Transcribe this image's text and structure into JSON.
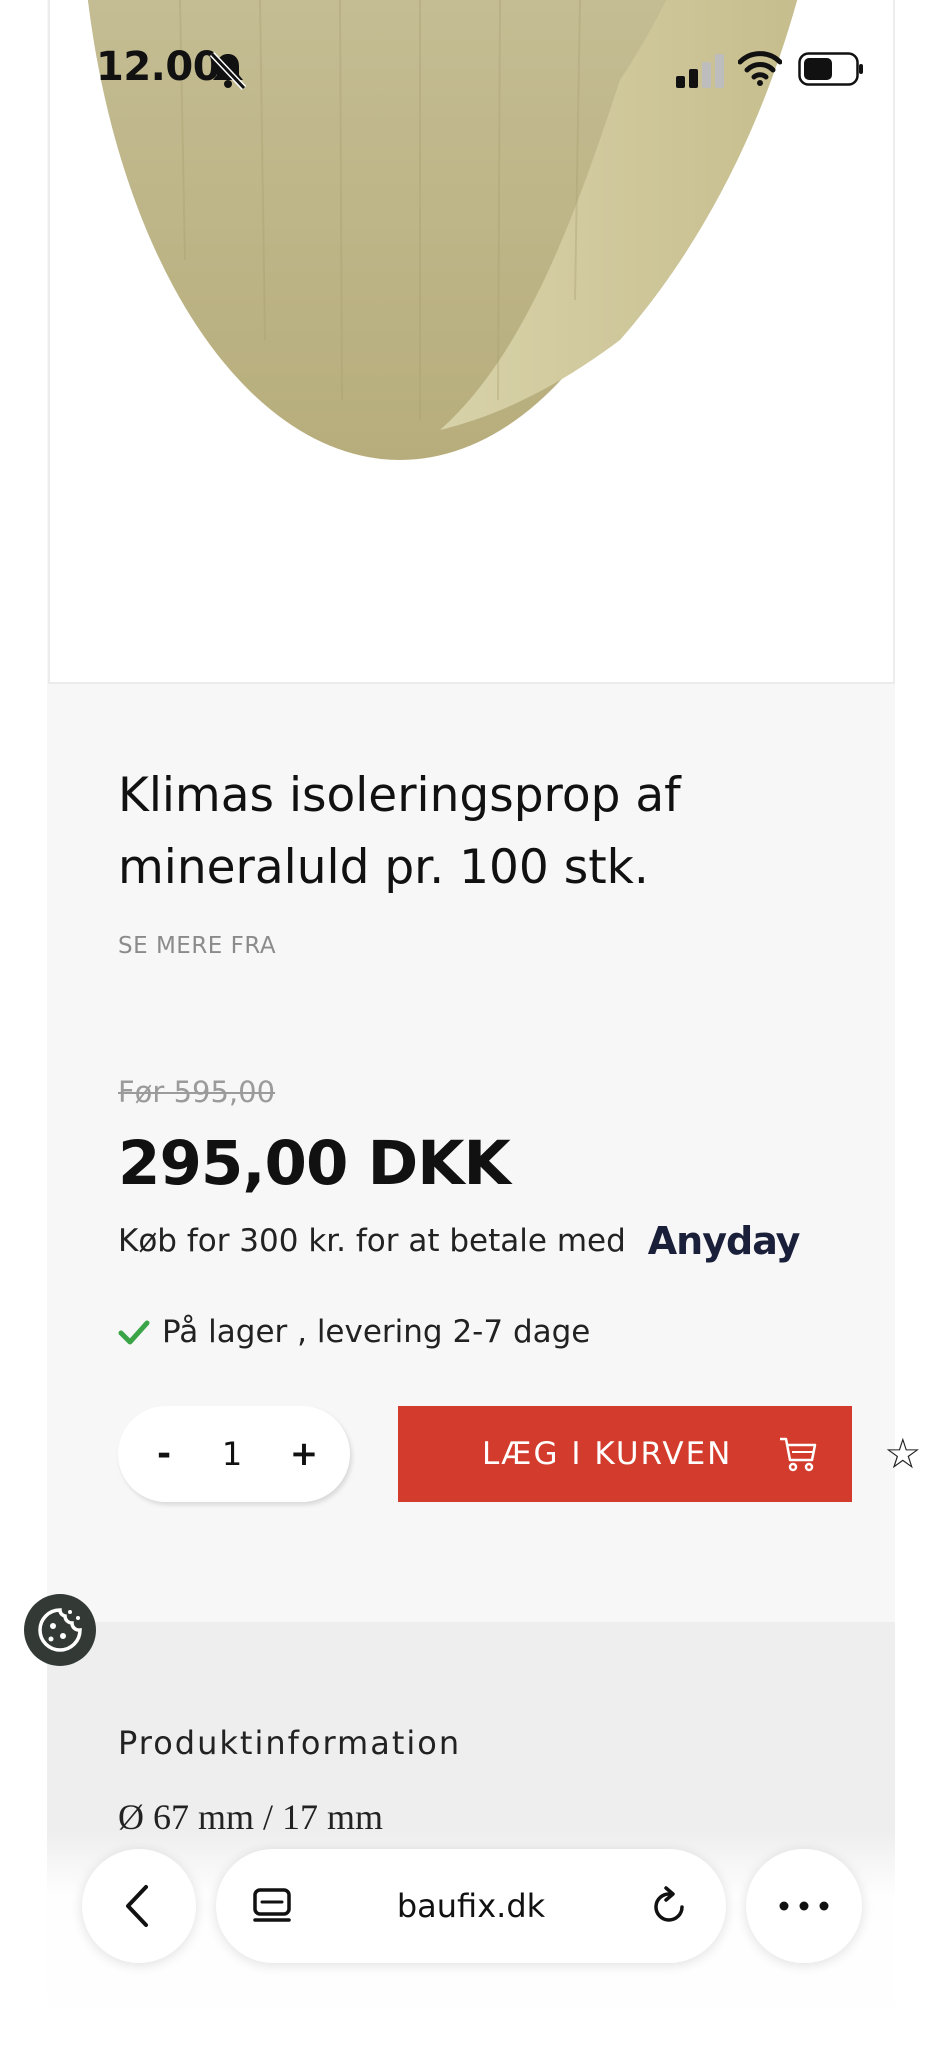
{
  "status_bar": {
    "time": "12.00",
    "icons": [
      "bell-slash-icon",
      "cellular-signal-icon",
      "wifi-icon",
      "battery-icon"
    ]
  },
  "product": {
    "image_alt": "mineral wool insulation plug",
    "title": "Klimas isoleringsprop af mineraluld pr. 100 stk.",
    "see_more_label": "SE MERE FRA",
    "old_price": "Før 595,00",
    "price": "295,00 DKK",
    "anyday_text": "Køb for 300 kr. for at betale med",
    "anyday_logo": "Anyday",
    "stock_text": "På lager , levering 2-7 dage"
  },
  "quantity": {
    "minus_label": "-",
    "value": "1",
    "plus_label": "+"
  },
  "cart": {
    "button_label": "LÆG I KURVEN"
  },
  "info": {
    "section_title": "Produktinformation",
    "dimensions": "Ø 67 mm / 17 mm"
  },
  "browser": {
    "url": "baufix.dk",
    "icons": [
      "back-arrow-icon",
      "tabs-icon",
      "reload-icon",
      "more-icon"
    ]
  },
  "colors": {
    "accent_red": "#d33b2c",
    "stock_green": "#3aa447",
    "page_bg": "#f7f7f7",
    "info_bg": "#eeeeee"
  }
}
